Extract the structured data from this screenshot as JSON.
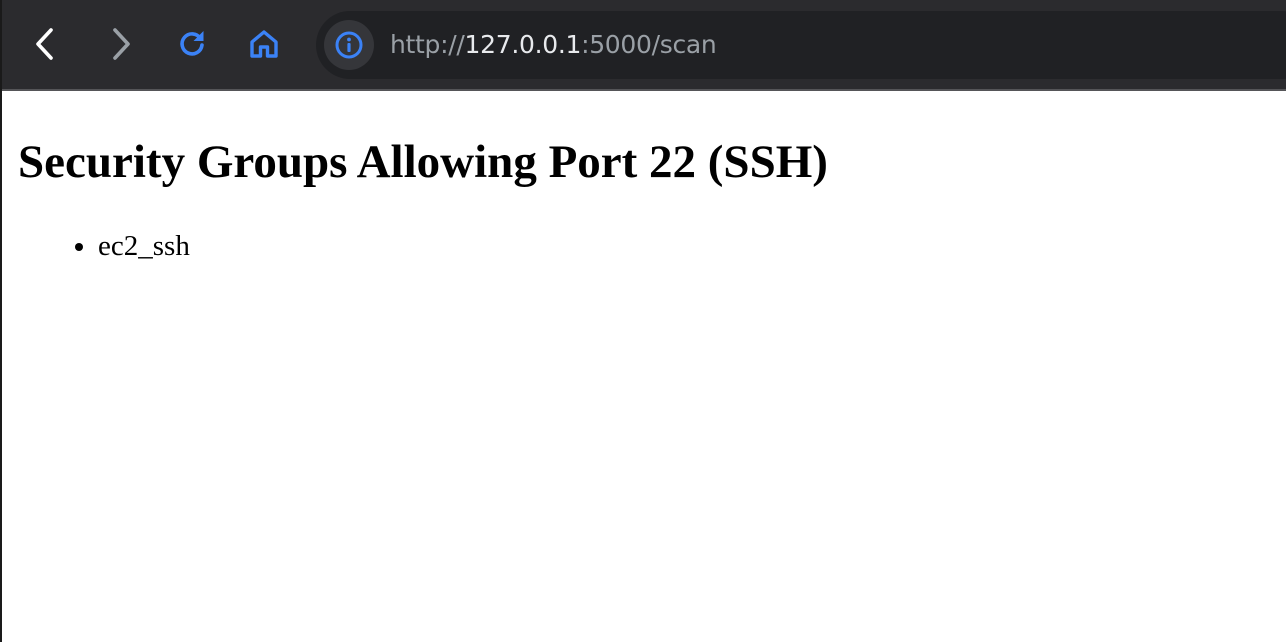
{
  "browser": {
    "url": {
      "scheme": "http://",
      "host": "127.0.0.1",
      "rest": ":5000/scan"
    },
    "icons": {
      "back": "back-arrow-icon",
      "forward": "forward-arrow-icon",
      "reload": "reload-icon",
      "home": "home-icon",
      "site_info": "info-icon"
    },
    "colors": {
      "toolbar": "#2b2b2e",
      "address_bar": "#202124",
      "accent": "#3b82f6"
    }
  },
  "page": {
    "heading": "Security Groups Allowing Port 22 (SSH)",
    "items": [
      "ec2_ssh"
    ]
  }
}
